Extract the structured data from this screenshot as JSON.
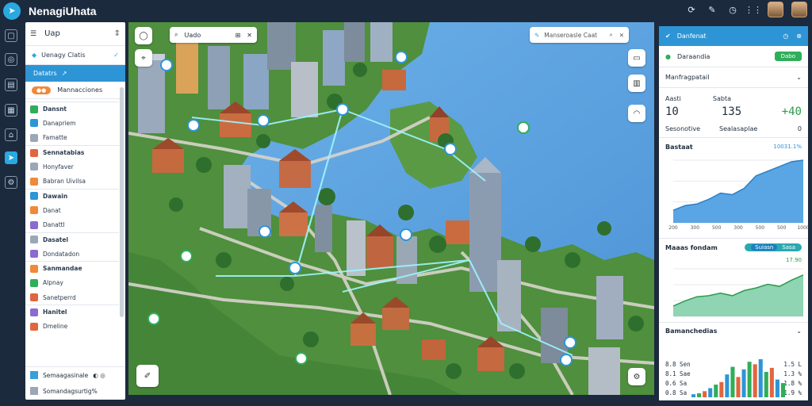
{
  "app": {
    "title": "NenagiUhata"
  },
  "top_icons": [
    "refresh-icon",
    "edit-icon",
    "clock-icon",
    "grid-icon",
    "avatar",
    "avatar"
  ],
  "left_panel": {
    "title": "Uap",
    "subheader": "Uenagy Clatis",
    "active_item": "Datatrs",
    "badge_label": "Mannacciones",
    "groups": [
      {
        "label": "Dansnt",
        "items": [
          "Danapriem",
          "Famatte"
        ]
      },
      {
        "label": "Sennatabias",
        "items": [
          "Honyfaver",
          "Babran Uivilsa"
        ]
      },
      {
        "label": "Dawain",
        "items": [
          "Danat",
          "Danattl"
        ]
      },
      {
        "label": "Dasatel",
        "items": [
          "Dondatadon"
        ]
      },
      {
        "label": "Sanmandae",
        "items": [
          "Alpnay",
          "Sanetperrd"
        ]
      },
      {
        "label": "Hanitel",
        "items": [
          "Dmeline"
        ]
      }
    ],
    "footer": [
      "Semaagasinale",
      "Somandagsurtig%"
    ]
  },
  "map": {
    "toolbar": [
      "Q",
      "Uado"
    ],
    "search_placeholder": "Manseroasle Caat",
    "cluster_count_note": ""
  },
  "right_panel": {
    "header": "Danfenat",
    "row1_label": "Daraandia",
    "row1_button": "Dabo",
    "section_title": "Manfragpatail",
    "stats": [
      {
        "label": "Aasti",
        "value": "10"
      },
      {
        "label": "Sabta",
        "value": "135"
      },
      {
        "label": "",
        "value": "+40"
      }
    ],
    "stats_labels2": [
      "Sesonotive",
      "Sealasaplae",
      "0"
    ],
    "chart1": {
      "title": "Bastaat",
      "value_label": "10031.1%"
    },
    "chart2": {
      "title": "Maaas fondam",
      "toggle_off": "Sasa",
      "toggle_on": "Suiasn",
      "value_label": "17.90"
    },
    "chart3": {
      "title": "Bamanchedias"
    },
    "bottom_rows": [
      {
        "left": "8.8 Sen",
        "right": "1.5 L"
      },
      {
        "left": "8.1 Sae",
        "right": "1.3 %"
      },
      {
        "left": "0.6 Sa",
        "right": "1.8 %"
      },
      {
        "left": "0.8 Sa",
        "right": "1.9 %"
      }
    ]
  },
  "chart_data": [
    {
      "type": "area",
      "title": "Bastaat",
      "x": [
        "200",
        "300",
        "500",
        "300",
        "500",
        "500",
        "1000"
      ],
      "ylim": [
        0,
        200
      ],
      "series": [
        {
          "name": "",
          "values": [
            40,
            55,
            60,
            75,
            95,
            90,
            110,
            150,
            165,
            180,
            195,
            200
          ]
        }
      ]
    },
    {
      "type": "area",
      "title": "Maaas fondam",
      "series": [
        {
          "name": "",
          "values": [
            20,
            30,
            38,
            40,
            45,
            40,
            50,
            55,
            62,
            58,
            70,
            80
          ]
        }
      ]
    },
    {
      "type": "bar",
      "title": "Bamanchedias",
      "series": [
        {
          "name": "",
          "values": [
            6,
            8,
            12,
            18,
            25,
            30,
            45,
            60,
            40,
            55,
            70,
            65,
            75,
            50,
            58,
            35,
            28
          ]
        }
      ]
    }
  ],
  "colors": {
    "accent_blue": "#2d95d6",
    "cyan": "#2aa9e0",
    "green": "#2fae5a",
    "orange": "#f0893a",
    "water": "#5ea3e0",
    "land": "#4f8f3d"
  }
}
